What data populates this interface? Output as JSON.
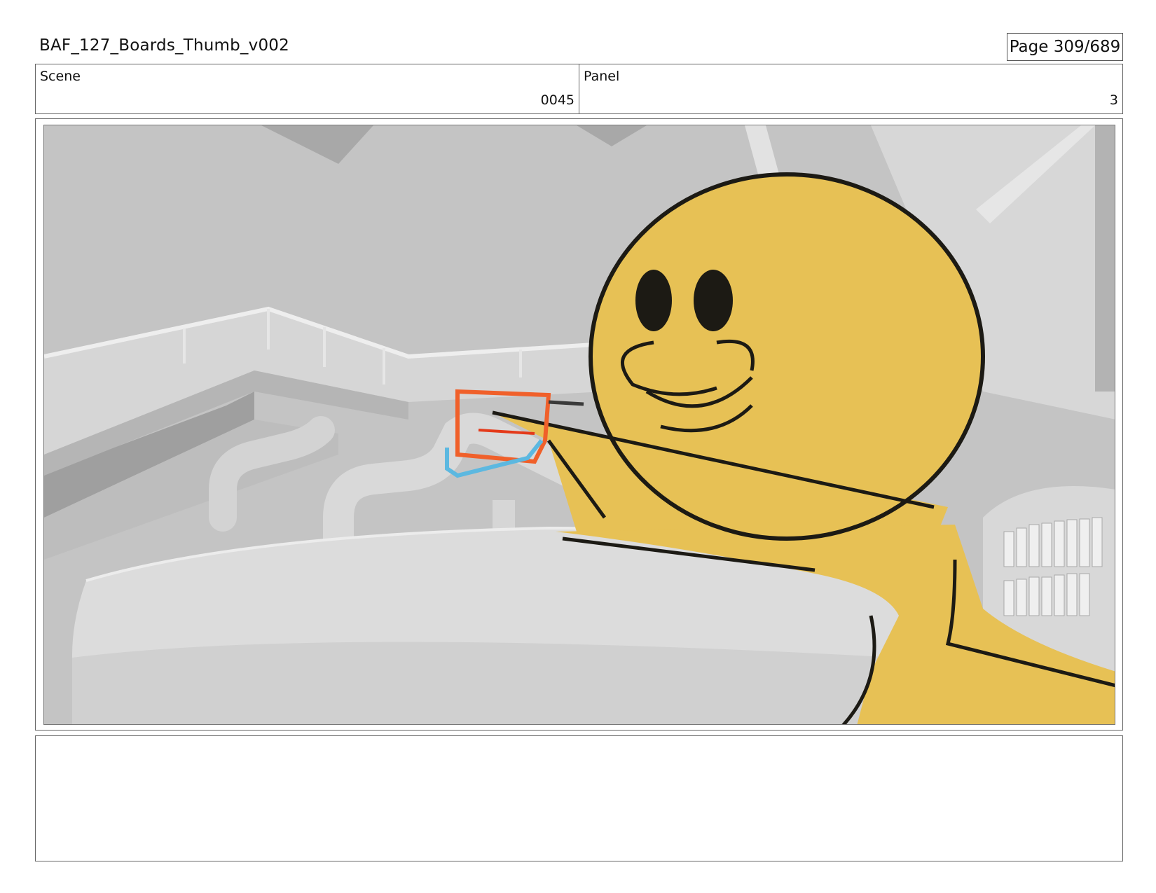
{
  "header": {
    "title": "BAF_127_Boards_Thumb_v002",
    "page": "Page 309/689"
  },
  "info": {
    "scene_label": "Scene",
    "scene_value": "0045",
    "panel_label": "Panel",
    "panel_value": "3"
  },
  "panel": {
    "description_colors": {
      "background_gray": "#c9c9c9",
      "character_yellow": "#e7c155",
      "outline": "#1c1a14",
      "marker_orange": "#f0602a",
      "marker_blue": "#5cb8e0"
    }
  },
  "notes": {
    "text": ""
  }
}
